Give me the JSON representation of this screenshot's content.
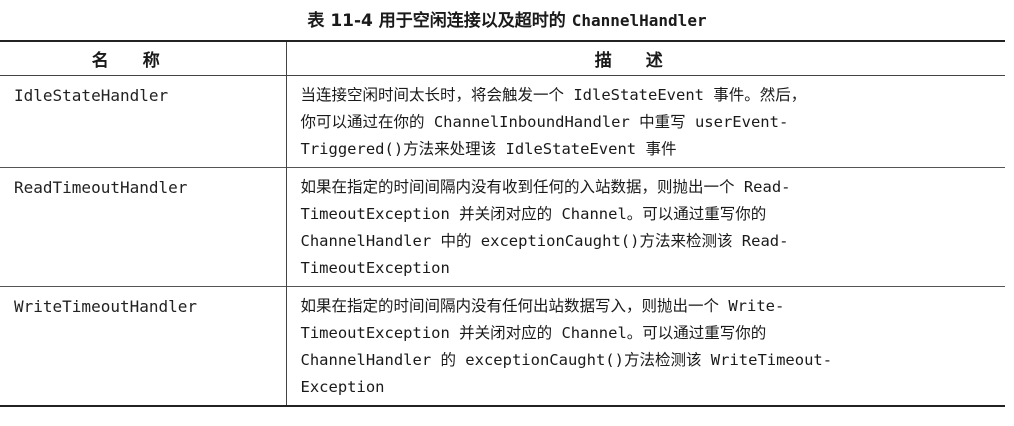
{
  "caption": {
    "prefix": "表 11-4   用于空闲连接以及超时的 ",
    "code": "ChannelHandler"
  },
  "table": {
    "headers": [
      "名称",
      "描述"
    ],
    "rows": [
      {
        "name": "IdleStateHandler",
        "lines": [
          "当连接空闲时间太长时，将会触发一个 IdleStateEvent 事件。然后，",
          "你可以通过在你的 ChannelInboundHandler 中重写 userEvent-",
          "Triggered()方法来处理该 IdleStateEvent 事件"
        ]
      },
      {
        "name": "ReadTimeoutHandler",
        "lines": [
          "如果在指定的时间间隔内没有收到任何的入站数据，则抛出一个 Read-",
          "TimeoutException 并关闭对应的 Channel。可以通过重写你的",
          "ChannelHandler 中的 exceptionCaught()方法来检测该 Read-",
          "TimeoutException"
        ]
      },
      {
        "name": "WriteTimeoutHandler",
        "lines": [
          "如果在指定的时间间隔内没有任何出站数据写入，则抛出一个 Write-",
          "TimeoutException 并关闭对应的 Channel。可以通过重写你的",
          "ChannelHandler 的 exceptionCaught()方法检测该 WriteTimeout-",
          "Exception"
        ]
      }
    ]
  }
}
